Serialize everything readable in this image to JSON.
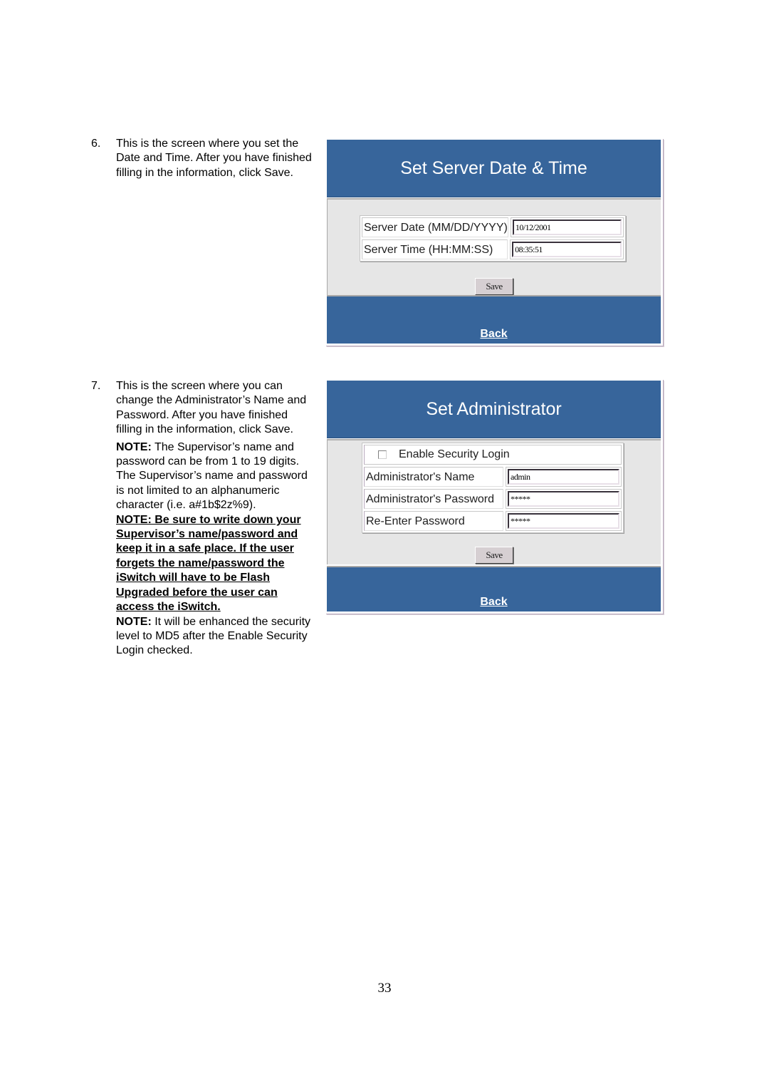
{
  "steps": [
    {
      "number": "6.",
      "text": "This is the screen where you set the Date and Time.  After you have finished filling in the information, click Save."
    },
    {
      "number": "7.",
      "text": "This is the screen where you can change the Administrator’s Name and Password.  After you have finished filling in the information, click Save.",
      "note1_label": "NOTE:",
      "note1_text": " The Supervisor’s name and password can be from 1 to 19 digits.  The Supervisor’s name and password is not limited to an alphanumeric character (i.e. a#1b$2z%9).",
      "warning": "NOTE: Be sure to write down your Supervisor’s name/password and keep it in a safe place.  If the user forgets the name/password the iSwitch will have to be Flash Upgraded before the user can access the iSwitch.",
      "note2_label": "NOTE:",
      "note2_text": " It will be enhanced the security level to MD5 after the Enable Security Login checked."
    }
  ],
  "date_time_panel": {
    "title": "Set Server Date & Time",
    "fields": [
      {
        "label": "Server Date (MM/DD/YYYY)",
        "value": "10/12/2001"
      },
      {
        "label": "Server Time (HH:MM:SS)",
        "value": "08:35:51"
      }
    ],
    "save_label": "Save",
    "back_label": "Back"
  },
  "admin_panel": {
    "title": "Set Administrator",
    "checkbox_label": "Enable Security Login",
    "checkbox_checked": false,
    "fields": [
      {
        "label": "Administrator's Name",
        "value": "admin"
      },
      {
        "label": "Administrator's Password",
        "value": "*****"
      },
      {
        "label": "Re-Enter Password",
        "value": "*****"
      }
    ],
    "save_label": "Save",
    "back_label": "Back"
  },
  "colors": {
    "header_blue": "#37659b",
    "body_gray": "#e6e6e6"
  },
  "page_number": "33"
}
